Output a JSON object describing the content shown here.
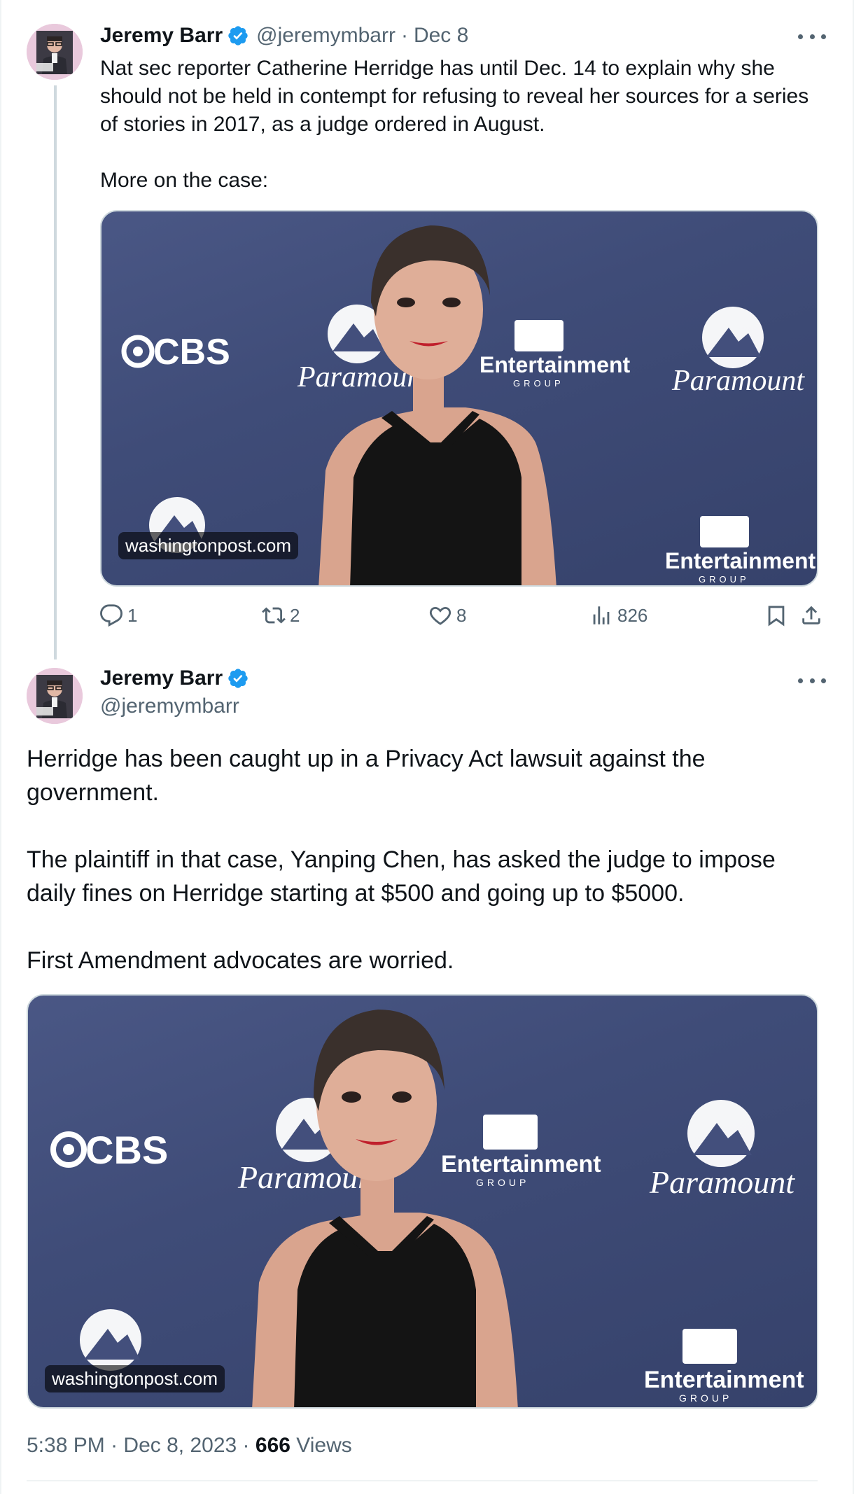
{
  "tweet1": {
    "author_name": "Jeremy Barr",
    "handle": "@jeremymbarr",
    "separator": "·",
    "date": "Dec 8",
    "text": "Nat sec reporter Catherine Herridge has until Dec. 14 to explain why she should not be held in contempt for refusing to reveal her sources for a series of stories in 2017, as a judge ordered in August.\n\nMore on the case:",
    "media_source": "washingtonpost.com",
    "backdrop_logos": [
      "CBS",
      "Paramount",
      "Entertainment",
      "GROUP"
    ],
    "actions": {
      "reply_count": "1",
      "retweet_count": "2",
      "like_count": "8",
      "views_count": "826"
    }
  },
  "tweet2": {
    "author_name": "Jeremy Barr",
    "handle": "@jeremymbarr",
    "text": "Herridge has been caught up in a Privacy Act lawsuit against the government.\n\nThe plaintiff in that case, Yanping Chen, has asked the judge to impose daily fines on Herridge starting at $500 and going up to $5000.\n\nFirst Amendment advocates are worried.",
    "media_source": "washingtonpost.com",
    "backdrop_logos": [
      "CBS",
      "Paramount",
      "Entertainment",
      "GROUP"
    ],
    "timestamp_time": "5:38 PM",
    "timestamp_date": "Dec 8, 2023",
    "timestamp_separator": "·",
    "views_count": "666",
    "views_label": "Views"
  },
  "colors": {
    "verified_blue": "#1d9bf0",
    "text_primary": "#0f1419",
    "text_secondary": "#536471",
    "backdrop": "#434f7c"
  },
  "icons": [
    "verified-badge-icon",
    "more-icon",
    "reply-icon",
    "retweet-icon",
    "like-icon",
    "views-icon",
    "bookmark-icon",
    "share-icon"
  ]
}
